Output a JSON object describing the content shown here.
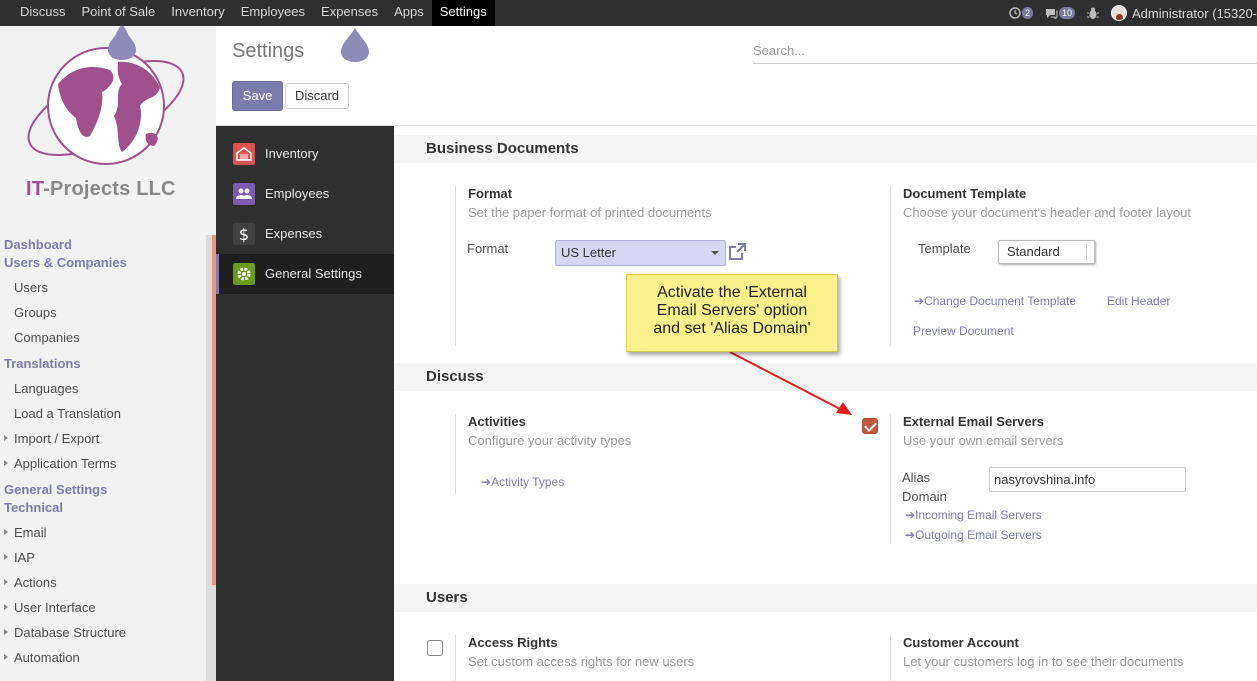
{
  "topnav": {
    "items": [
      {
        "label": "Discuss"
      },
      {
        "label": "Point of Sale"
      },
      {
        "label": "Inventory"
      },
      {
        "label": "Employees"
      },
      {
        "label": "Expenses"
      },
      {
        "label": "Apps"
      },
      {
        "label": "Settings"
      }
    ],
    "active": "Settings",
    "activity_count": "2",
    "message_count": "10",
    "user": "Administrator (15320-"
  },
  "sidebar": {
    "company_name_prefix": "IT",
    "company_name_rest": "-Projects LLC",
    "sections": [
      {
        "heading": "Dashboard"
      },
      {
        "heading": "Users & Companies",
        "items": [
          "Users",
          "Groups",
          "Companies"
        ]
      },
      {
        "heading": "Translations",
        "items": [
          "Languages",
          "Load a Translation",
          "Import / Export",
          "Application Terms"
        ]
      },
      {
        "heading": "General Settings"
      },
      {
        "heading": "Technical",
        "items": [
          "Email",
          "IAP",
          "Actions",
          "User Interface",
          "Database Structure",
          "Automation"
        ]
      }
    ]
  },
  "control_panel": {
    "title": "Settings",
    "save_label": "Save",
    "discard_label": "Discard",
    "search_placeholder": "Search..."
  },
  "apps": [
    {
      "label": "Inventory",
      "color": "#d9534f"
    },
    {
      "label": "Employees",
      "color": "#7c5cb0"
    },
    {
      "label": "Expenses",
      "color": "#404040"
    },
    {
      "label": "General Settings",
      "color": "#6a9b1e",
      "active": true
    }
  ],
  "business_documents": {
    "heading": "Business Documents",
    "format": {
      "title": "Format",
      "description": "Set the paper format of printed documents",
      "field_label": "Format",
      "value": "US Letter"
    },
    "document_template": {
      "title": "Document Template",
      "description": "Choose your document's header and footer layout",
      "field_label": "Template",
      "value": "Standard",
      "change_link": "Change Document Template",
      "edit_header_link": "Edit Header",
      "preview_link": "Preview Document"
    }
  },
  "discuss": {
    "heading": "Discuss",
    "activities": {
      "title": "Activities",
      "description": "Configure your activity types",
      "link": "Activity Types"
    },
    "external_email": {
      "title": "External Email Servers",
      "description": "Use your own email servers",
      "checked": true,
      "alias_label_line1": "Alias",
      "alias_label_line2": "Domain",
      "alias_value": "nasyrovshina.info",
      "incoming_link": "Incoming Email Servers",
      "outgoing_link": "Outgoing Email Servers"
    }
  },
  "users": {
    "heading": "Users",
    "access_rights": {
      "title": "Access Rights",
      "description": "Set custom access rights for new users",
      "checked": false
    },
    "customer_account": {
      "title": "Customer Account",
      "description": "Let your customers log in to see their documents"
    }
  },
  "callout": {
    "line1": "Activate the 'External",
    "line2": "Email Servers' option",
    "line3": "and set 'Alias Domain'"
  }
}
